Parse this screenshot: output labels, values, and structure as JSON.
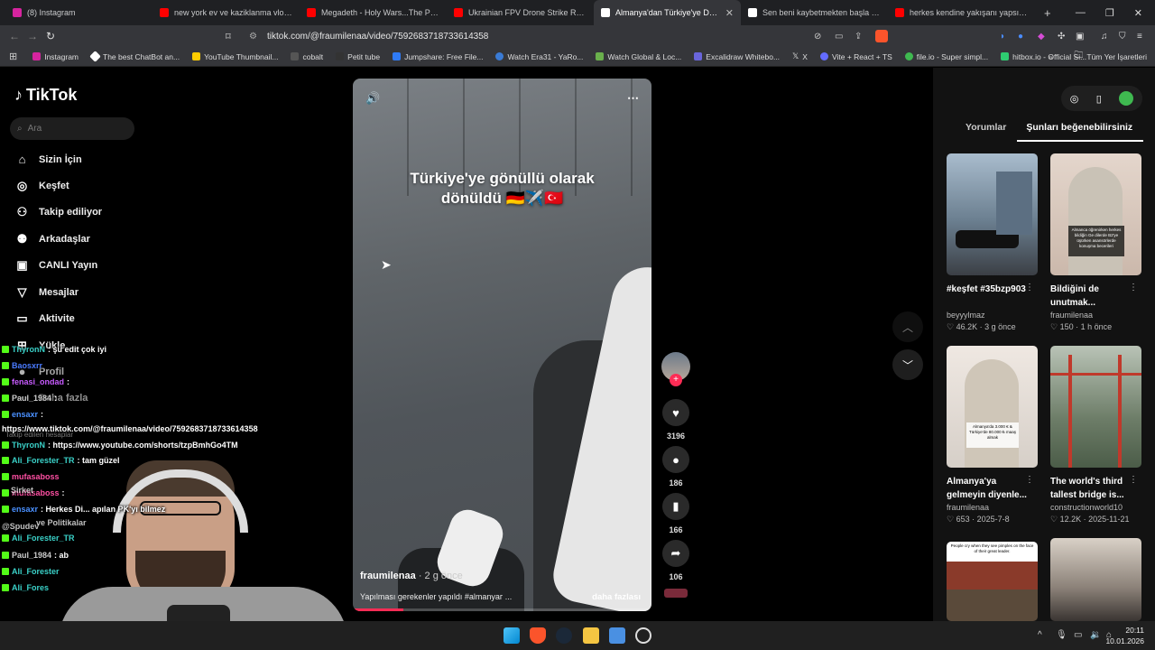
{
  "browser": {
    "tabs": [
      {
        "title": "(8) Instagram",
        "color": "#d6249f"
      },
      {
        "title": "new york ev ve kaziklanma vlogu - Y",
        "color": "#ff0000"
      },
      {
        "title": "Megadeth - Holy Wars...The Punishm",
        "color": "#ff0000"
      },
      {
        "title": "Ukrainian FPV Drone Strike Russian S",
        "color": "#ff0000"
      },
      {
        "title": "Almanya'dan Türkiye'ye Dönüş S",
        "color": "#ffffff"
      },
      {
        "title": "Sen beni kaybetmekten başla #taksi",
        "color": "#ffffff"
      },
      {
        "title": "herkes kendine yakışanı yapsın truck",
        "color": "#ff0000"
      }
    ],
    "url": "tiktok.com/@fraumilenaa/video/7592683718733614358",
    "bookmarks": [
      {
        "label": "Instagram",
        "color": "#d6249f"
      },
      {
        "label": "The best ChatBot an...",
        "color": "#ffffff"
      },
      {
        "label": "YouTube Thumbnail...",
        "color": "#ffcc00"
      },
      {
        "label": "cobalt",
        "color": "#444444"
      },
      {
        "label": "Petit tube",
        "color": "#333333"
      },
      {
        "label": "Jumpshare: Free File...",
        "color": "#2f7bf6"
      },
      {
        "label": "Watch Era31 - YaRo...",
        "color": "#3a7bd5"
      },
      {
        "label": "Watch Global & Loc...",
        "color": "#6ab04c"
      },
      {
        "label": "Excalidraw Whitebo...",
        "color": "#6965db"
      },
      {
        "label": "X",
        "color": "#000000"
      },
      {
        "label": "Vite + React + TS",
        "color": "#646cff"
      },
      {
        "label": "file.io - Super simpl...",
        "color": "#3fb950"
      },
      {
        "label": "hitbox.io - Official Si...",
        "color": "#2ecc71"
      }
    ],
    "all_bookmarks": "Tüm Yer İşaretleri"
  },
  "sidebar": {
    "logo": "TikTok",
    "search_placeholder": "Ara",
    "items": [
      {
        "label": "Sizin İçin",
        "icon": "home-icon"
      },
      {
        "label": "Keşfet",
        "icon": "compass-icon"
      },
      {
        "label": "Takip ediliyor",
        "icon": "person-plus-icon"
      },
      {
        "label": "Arkadaşlar",
        "icon": "people-icon"
      },
      {
        "label": "CANLI Yayın",
        "icon": "live-icon"
      },
      {
        "label": "Mesajlar",
        "icon": "message-icon"
      },
      {
        "label": "Aktivite",
        "icon": "inbox-icon"
      },
      {
        "label": "Yükle",
        "icon": "upload-icon"
      },
      {
        "label": "Profil",
        "icon": "profile-icon"
      },
      {
        "label": "Daha fazla",
        "icon": "more-icon"
      }
    ],
    "following_header": "Takip edilen hesaplar"
  },
  "video": {
    "caption": "Türkiye'ye gönüllü olarak dönüldü 🇩🇪✈️🇹🇷",
    "author": "fraumilenaa",
    "time_ago": "· 2 g önce",
    "description": "Yapılması gerekenler yapıldı #almanyaг ...",
    "more": "daha fazlası",
    "progress": 0.17
  },
  "actions": {
    "likes": "3196",
    "comments": "186",
    "saves": "166",
    "shares": "106"
  },
  "right_panel": {
    "tabs": [
      "Yorumlar",
      "Şunları beğenebilirsiniz"
    ],
    "cards": [
      {
        "title": "#keşfet #35bzp903",
        "author": "beyyylmaz",
        "likes": "46.2K",
        "when": "3 g önce",
        "thumb": "car"
      },
      {
        "title": "Bildiğini de unutmak...",
        "author": "fraumilenaa",
        "likes": "150",
        "when": "1 h önce",
        "thumb": "woman"
      },
      {
        "title": "Almanya'ya gelmeyin diyenle...",
        "author": "fraumilenaa",
        "likes": "653",
        "when": "2025-7-8",
        "thumb": "woman"
      },
      {
        "title": "The world's third tallest bridge is...",
        "author": "constructionworld10",
        "likes": "12.2K",
        "when": "2025-11-21",
        "thumb": "bridge"
      },
      {
        "title": "",
        "author": "",
        "likes": "",
        "when": "",
        "thumb": "crowd"
      },
      {
        "title": "",
        "author": "",
        "likes": "",
        "when": "",
        "thumb": "room"
      }
    ],
    "thumb_texts": {
      "car": "",
      "woman1": "Almanca öğrenirken herkes bildiğin Ge dilerde B2'ye üşürken asansörlerde konuşma becerileri",
      "woman2": "Almanya'da 3.000 € & Türkiye'de 80.000 ₺ maaş almak",
      "crowd": "People cry when they see pimples on the face of their great leader."
    }
  },
  "chat": [
    {
      "user": "ThyronN",
      "msg": ": şu edit çok iyi",
      "color": "#3ad1c8"
    },
    {
      "user": "Baosxrr",
      "msg": "",
      "color": "#4a7bff"
    },
    {
      "user": "fenasi_ondad",
      "msg": ":",
      "color": "#c85bff"
    },
    {
      "user": "Paul_1984",
      "msg": ":",
      "color": "#cccccc"
    },
    {
      "user": "ensaxr",
      "msg": ":",
      "color": "#4a90ff"
    },
    {
      "user": "",
      "msg": "https://www.tiktok.com/@fraumilenaa/video/7592683718733614358",
      "color": "#ffffff"
    },
    {
      "user": "ThyronN",
      "msg": ": https://www.youtube.com/shorts/tzpBmhGo4TM",
      "color": "#3ad1c8"
    },
    {
      "user": "Ali_Forester_TR",
      "msg": ": tam güzel",
      "color": "#3ad1c8"
    },
    {
      "user": "mufasaboss",
      "msg": "",
      "color": "#ff4fa3"
    },
    {
      "user": "mufasaboss",
      "msg": ":",
      "color": "#ff4fa3"
    },
    {
      "user": "ensaxr",
      "msg": ": Herkes Di... apılan PK'yı bilmez",
      "color": "#4a90ff"
    },
    {
      "user": "Ali_Forester_TR",
      "msg": "",
      "color": "#3ad1c8"
    },
    {
      "user": "Paul_1984",
      "msg": ": ab",
      "color": "#cccccc"
    },
    {
      "user": "Ali_Forester",
      "msg": "",
      "color": "#3ad1c8"
    },
    {
      "user": "Ali_Fores",
      "msg": "",
      "color": "#3ad1c8"
    }
  ],
  "chat_extra": {
    "spudev": "@Spudev",
    "politikalar": "ve Politikalar",
    "sirket": "Şirket"
  },
  "taskbar": {
    "time": "20:11",
    "date": "10.01.2026"
  }
}
